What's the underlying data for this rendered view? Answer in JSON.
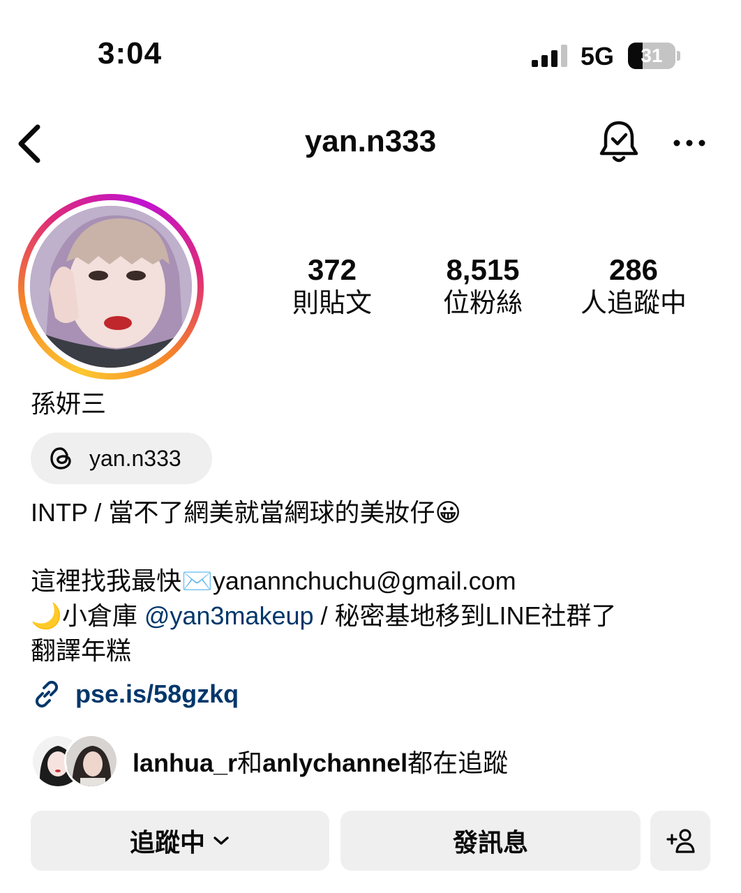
{
  "status_bar": {
    "time": "3:04",
    "network": "5G",
    "battery_level": "31",
    "battery_fraction": 0.31
  },
  "header": {
    "username": "yan.n333",
    "back_icon": "chevron-left-icon",
    "notification_icon": "bell-check-icon",
    "more_icon": "more-horizontal-icon"
  },
  "stats": [
    {
      "value": "372",
      "label": "則貼文"
    },
    {
      "value": "8,515",
      "label": "位粉絲"
    },
    {
      "value": "286",
      "label": "人追蹤中"
    }
  ],
  "profile": {
    "display_name": "孫妍三",
    "threads_handle": "yan.n333",
    "bio_line1": "INTP / 當不了網美就當網球的美妝仔😀",
    "bio_line2": "這裡找我最快✉️yanannchuchu@gmail.com",
    "bio_line3_prefix": "🌙小倉庫 ",
    "bio_line3_mention": "@yan3makeup",
    "bio_line3_suffix": " / 秘密基地移到LINE社群了",
    "bio_line4": "翻譯年糕",
    "link": "pse.is/58gzkq"
  },
  "followed_by": {
    "user1": "lanhua_r",
    "joiner": "和",
    "user2": "anlychannel",
    "suffix": "都在追蹤"
  },
  "actions": {
    "following_label": "追蹤中",
    "message_label": "發訊息",
    "suggest_icon": "add-person-icon"
  },
  "colors": {
    "link_blue": "#00376b",
    "button_bg": "#efefef"
  }
}
